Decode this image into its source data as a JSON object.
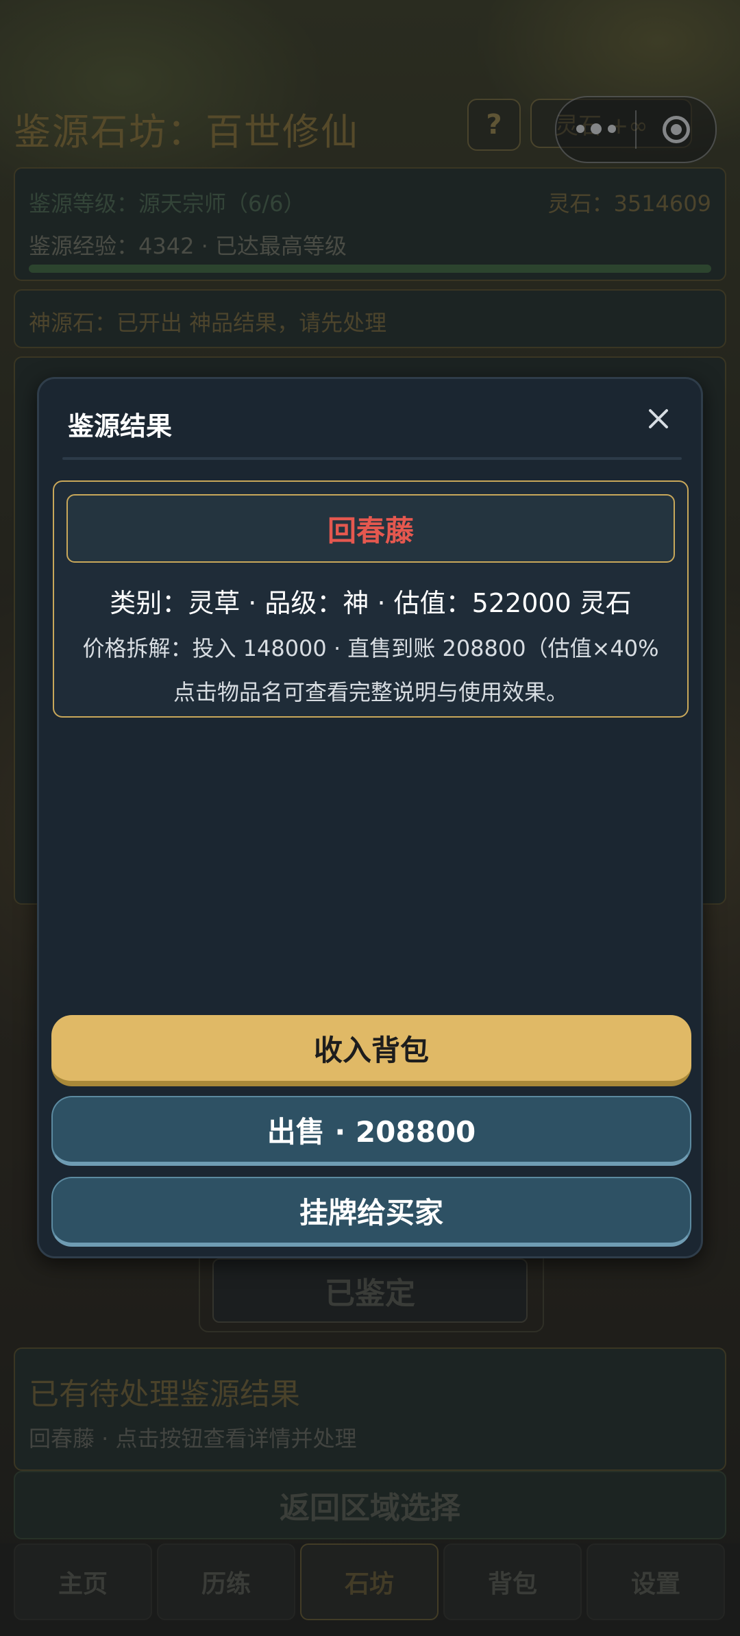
{
  "app": {
    "title": "鉴源石坊：百世修仙",
    "help_label": "?",
    "stone_chip_label": "灵石 +∞"
  },
  "level": {
    "level_text": "鉴源等级：源天宗师（6/6）",
    "stone_text": "灵石：3514609",
    "exp_text": "鉴源经验：4342 · 已达最高等级",
    "exp_progress": 1.0
  },
  "shenyuan": {
    "status_text": "神源石：已开出 神品结果，请先处理"
  },
  "identified_label": "已鉴定",
  "pending": {
    "title": "已有待处理鉴源结果",
    "subtitle": "回春藤 · 点击按钮查看详情并处理"
  },
  "return_label": "返回区域选择",
  "tabs": [
    {
      "label": "主页"
    },
    {
      "label": "历练"
    },
    {
      "label": "石坊",
      "active": true
    },
    {
      "label": "背包"
    },
    {
      "label": "设置"
    }
  ],
  "modal": {
    "title": "鉴源结果",
    "item_name": "回春藤",
    "info_line": "类别：灵草 · 品级：神 · 估值：522000 灵石",
    "price_line": "价格拆解：投入 148000 · 直售到账 208800（估值×40%",
    "hint_line": "点击物品名可查看完整说明与使用效果。",
    "collect_label": "收入背包",
    "sell_label": "出售 · 208800",
    "list_label": "挂牌给买家"
  },
  "colors": {
    "accent_gold": "#e0b966",
    "item_name_red": "#e5584f",
    "modal_bg": "#1b2631",
    "secondary_button": "#2e5164"
  },
  "icons": {
    "close": "close-icon",
    "miniprogram_menu": "more-dots-icon",
    "miniprogram_exit": "target-circle-icon"
  }
}
